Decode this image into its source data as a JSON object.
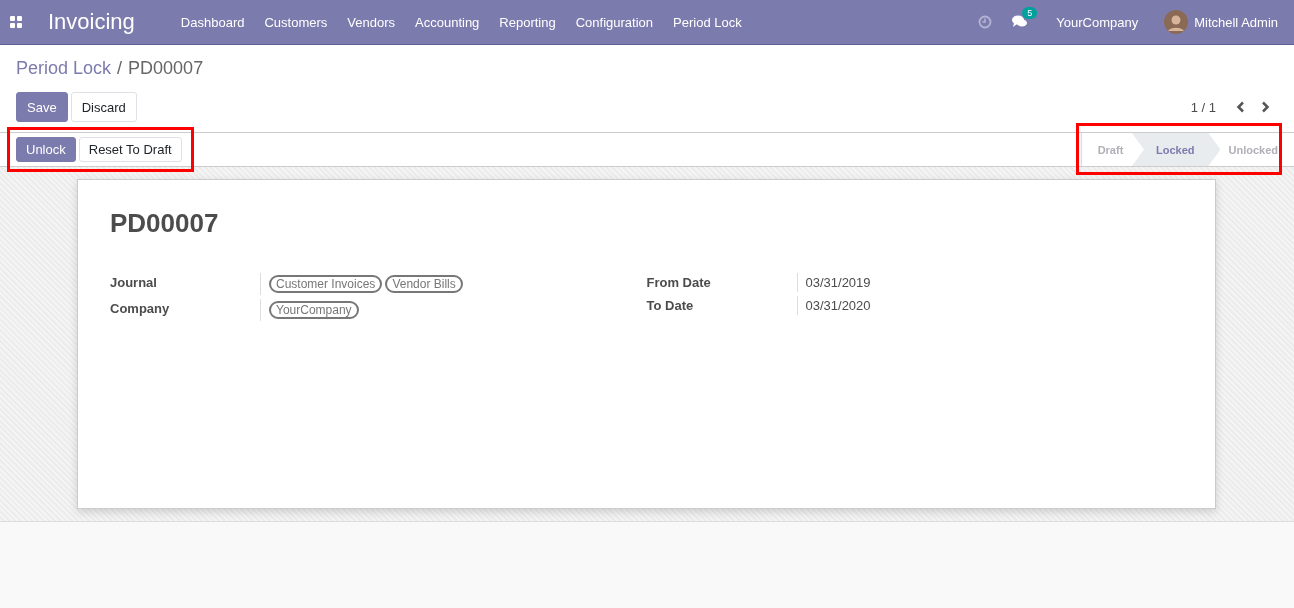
{
  "navbar": {
    "app_name": "Invoicing",
    "menu": [
      "Dashboard",
      "Customers",
      "Vendors",
      "Accounting",
      "Reporting",
      "Configuration",
      "Period Lock"
    ],
    "message_count": "5",
    "company": "YourCompany",
    "user": "Mitchell Admin"
  },
  "breadcrumb": {
    "parent": "Period Lock",
    "separator": "/",
    "current": "PD00007"
  },
  "buttons": [
    "Save",
    "Discard"
  ],
  "pager": "1 / 1",
  "header_buttons": [
    {
      "label": "Unlock",
      "primary": true
    },
    {
      "label": "Reset To Draft",
      "primary": false
    }
  ],
  "statusbar": [
    {
      "label": "Draft",
      "selected": false
    },
    {
      "label": "Locked",
      "selected": true
    },
    {
      "label": "Unlocked",
      "selected": false
    }
  ],
  "record": {
    "title": "PD00007",
    "left_fields": [
      {
        "label": "Journal",
        "tags": [
          "Customer Invoices",
          "Vendor Bills"
        ]
      },
      {
        "label": "Company",
        "tags": [
          "YourCompany"
        ]
      }
    ],
    "right_fields": [
      {
        "label": "From Date",
        "value": "03/31/2019"
      },
      {
        "label": "To Date",
        "value": "03/31/2020"
      }
    ]
  }
}
